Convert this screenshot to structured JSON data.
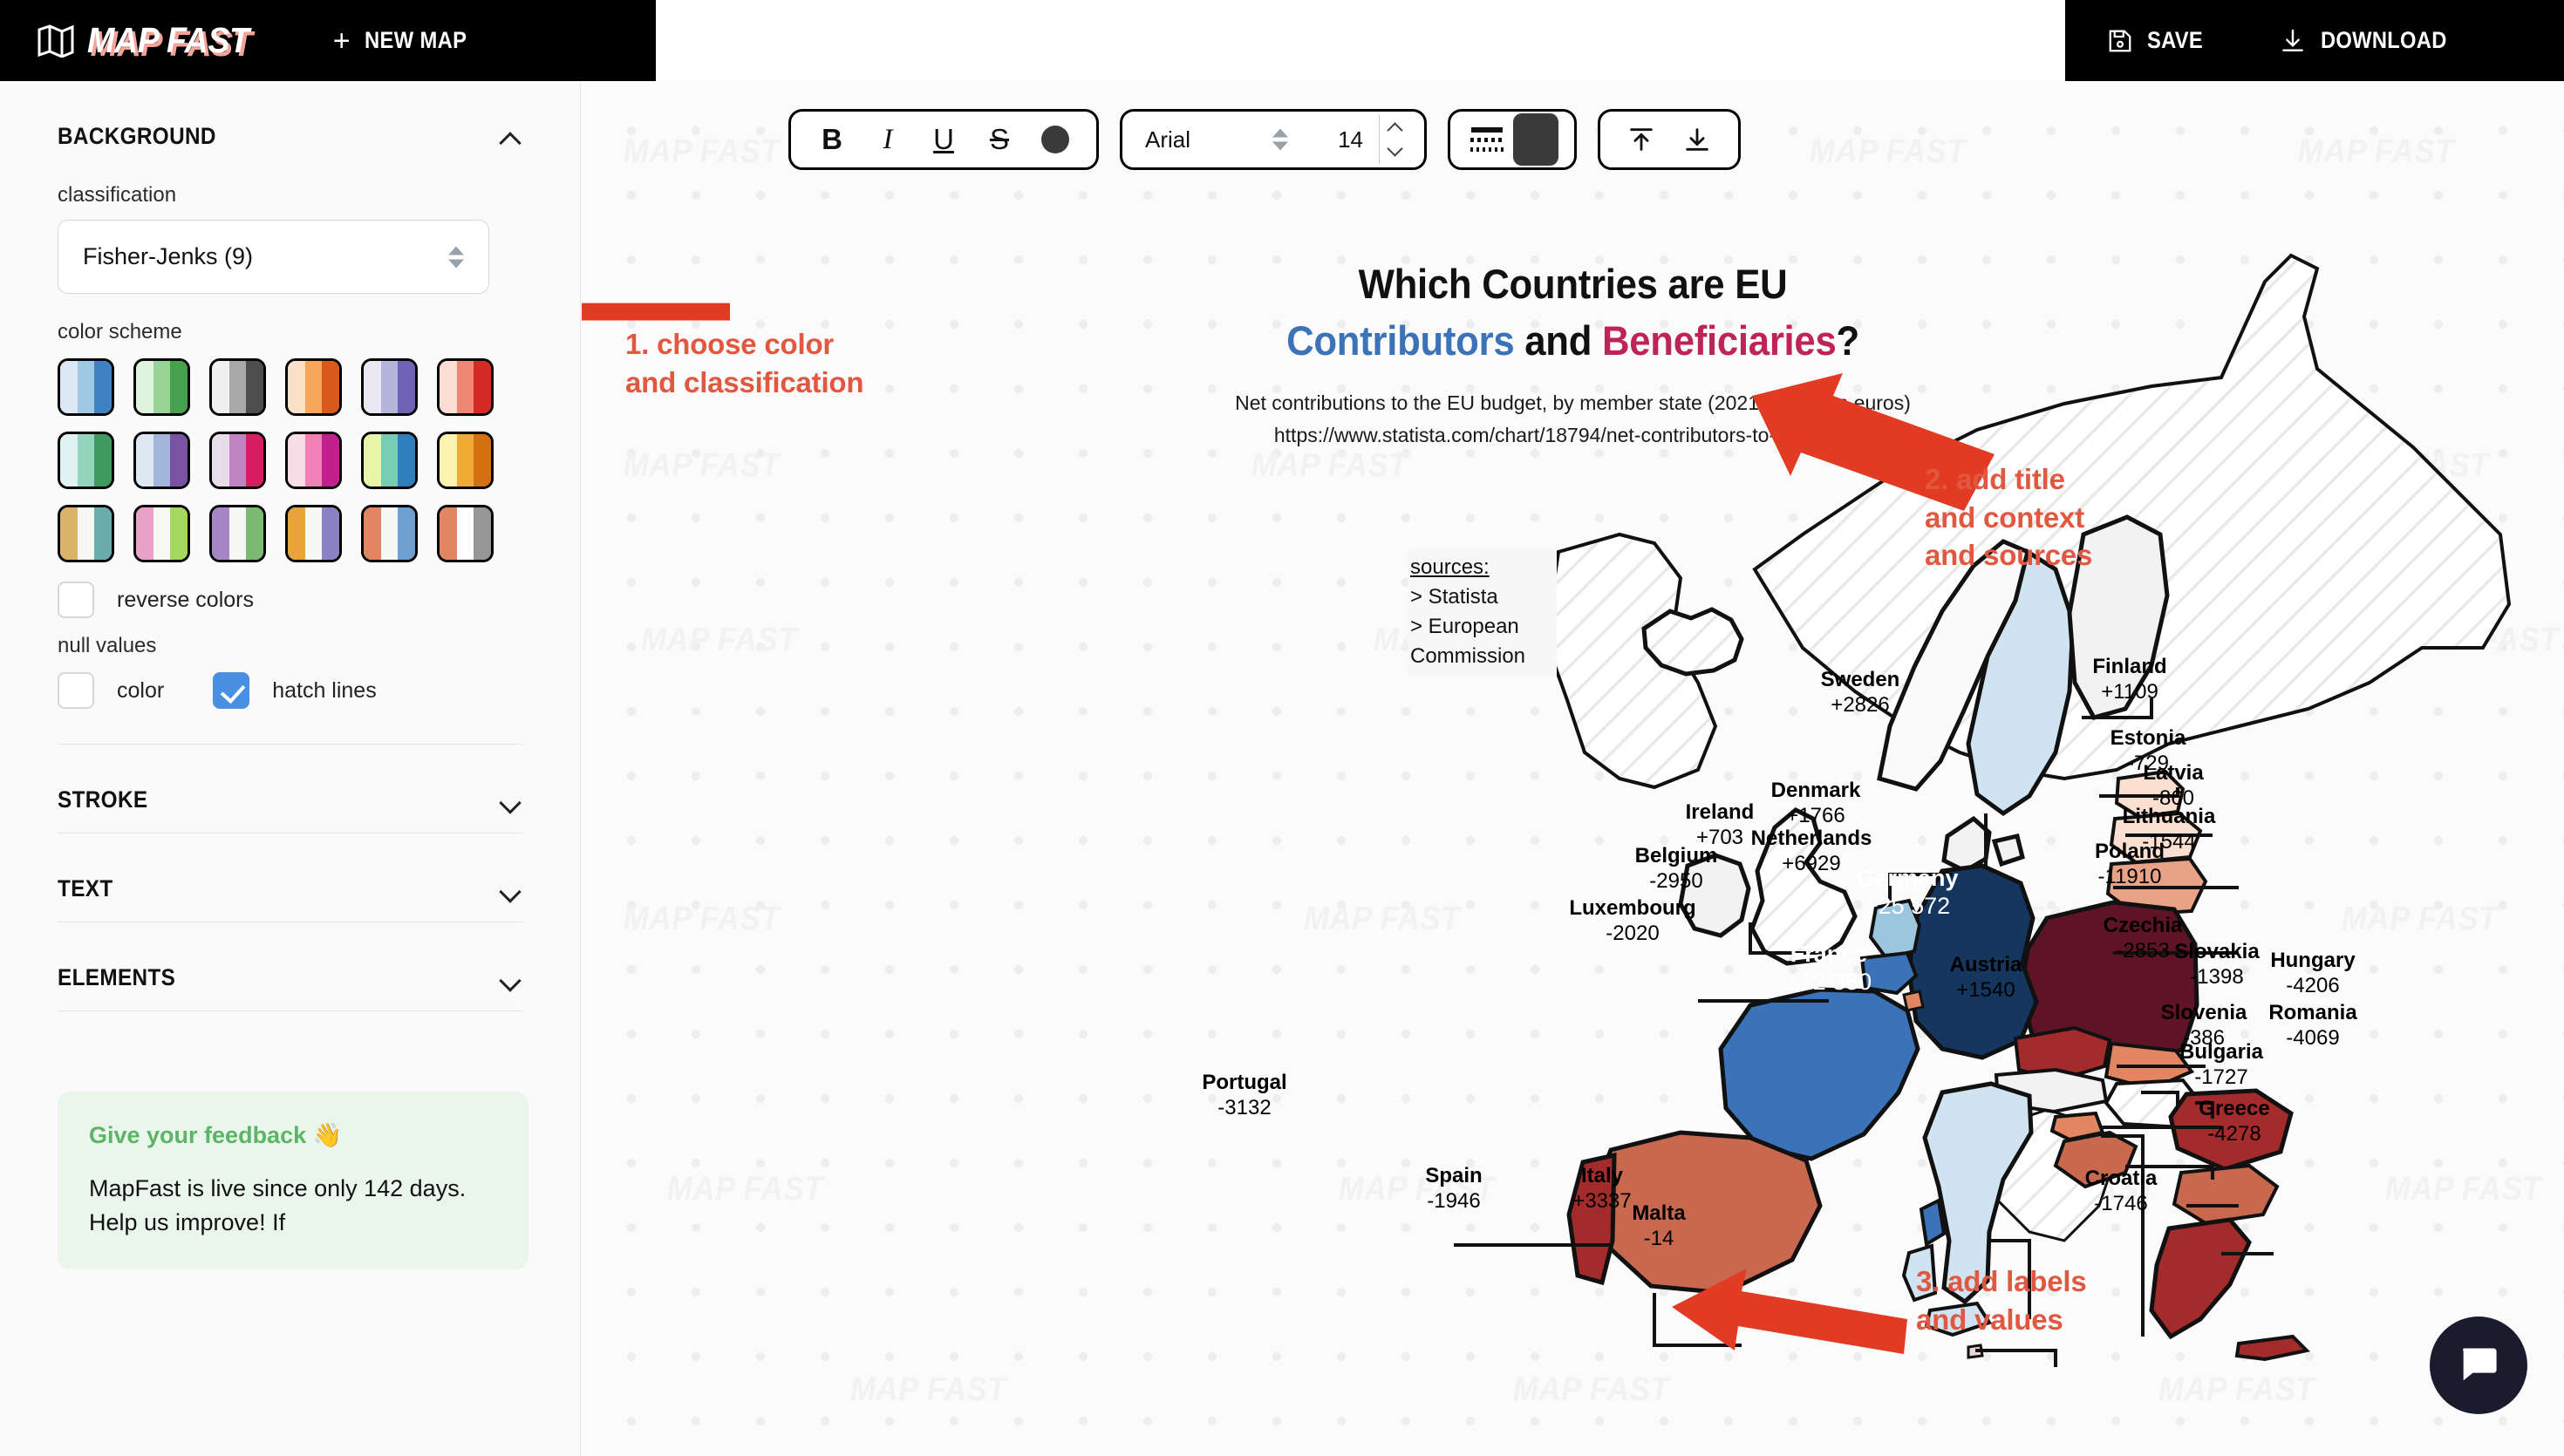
{
  "app": {
    "logo_text": "MAP FAST",
    "new_map_label": "NEW MAP",
    "plus": "+",
    "save_label": "SAVE",
    "download_label": "DOWNLOAD"
  },
  "sidebar": {
    "sections": [
      {
        "title": "BACKGROUND",
        "expanded": true
      },
      {
        "title": "STROKE",
        "expanded": false
      },
      {
        "title": "TEXT",
        "expanded": false
      },
      {
        "title": "ELEMENTS",
        "expanded": false
      }
    ],
    "background": {
      "classification_label": "classification",
      "classification_value": "Fisher-Jenks (9)",
      "color_scheme_label": "color scheme",
      "reverse_colors_label": "reverse colors",
      "reverse_colors_checked": false,
      "null_values_label": "null values",
      "null_color_label": "color",
      "null_color_checked": false,
      "null_hatch_label": "hatch lines",
      "null_hatch_checked": true,
      "schemes": [
        [
          "#dce9f5",
          "#9ec8e4",
          "#3e81c1"
        ],
        [
          "#e0f3df",
          "#96d394",
          "#46a14d"
        ],
        [
          "#f0f0f0",
          "#a8a8a8",
          "#4d4d4d"
        ],
        [
          "#fbe0c8",
          "#f5a65b",
          "#d9591b"
        ],
        [
          "#e9e8f2",
          "#b5b4da",
          "#6f61b5"
        ],
        [
          "#fbdfd5",
          "#ee8774",
          "#d32b23"
        ],
        [
          "#e0f2f2",
          "#93d4bd",
          "#3f9a5f"
        ],
        [
          "#dde8f3",
          "#a3b6d9",
          "#7a52a3"
        ],
        [
          "#e6dcea",
          "#c084c2",
          "#d91d62"
        ],
        [
          "#f8dce6",
          "#f27fb5",
          "#c41f8e"
        ],
        [
          "#e8f4a8",
          "#79ccb4",
          "#2f7fbd"
        ],
        [
          "#fcf3b0",
          "#f0ab35",
          "#d4700f"
        ],
        [
          "#d9b468",
          "#f6f6f4",
          "#69aeac"
        ],
        [
          "#e8a2c8",
          "#f7f7f5",
          "#a5d65e"
        ],
        [
          "#a487c4",
          "#f6f6f4",
          "#7cb972"
        ],
        [
          "#e9a33d",
          "#f7f7f5",
          "#8a82c4"
        ],
        [
          "#e28561",
          "#f7f7f5",
          "#6fa0cd"
        ],
        [
          "#e28561",
          "#ffffff",
          "#969696"
        ]
      ]
    },
    "feedback": {
      "title": "Give your feedback 👋",
      "body": "MapFast is live since only 142 days. Help us improve! If"
    }
  },
  "toolbar": {
    "bold": "B",
    "italic": "I",
    "underline": "U",
    "strike": "S",
    "text_color": "#3a3a3a",
    "font_family": "Arial",
    "font_size": "14",
    "fill_color": "#3a3a3a"
  },
  "map": {
    "title_line1": "Which Countries are EU",
    "title_part_contributors": "Contributors",
    "title_part_and": " and ",
    "title_part_beneficiaries": "Beneficiaries",
    "title_part_q": "?",
    "subtitle": "Net contributions to the EU budget, by member state (2021, in million euros)",
    "source_url": "https://www.statista.com/chart/18794/net-contributors-to-eu-budget/",
    "sources_heading": "sources:",
    "sources_items": [
      "> Statista",
      "> European Commission"
    ],
    "watermark": "MAP FAST",
    "colors": {
      "contributor_strong": "#14365f",
      "contributor_mid": "#3b72b8",
      "contributor_light": "#9cc6e0",
      "contributor_pale": "#cfe3f0",
      "beneficiary_strong": "#5e1424",
      "beneficiary_mid": "#a32b2b",
      "beneficiary_light": "#c8684f",
      "beneficiary_pale": "#f0c3ae",
      "null_fill": "#ffffff",
      "annotation": "#e2573f"
    }
  },
  "annotations": [
    {
      "id": 1,
      "text": "1. choose color\nand classification"
    },
    {
      "id": 2,
      "text": "2. add title\nand context\nand sources"
    },
    {
      "id": 3,
      "text": "3. add labels\nand values"
    }
  ],
  "chart_data": {
    "type": "choropleth-map",
    "title": "Which Countries are EU Contributors and Beneficiaries?",
    "subtitle": "Net contributions to the EU budget, by member state (2021, in million euros)",
    "unit": "million euros",
    "classification": "Fisher-Jenks (9)",
    "values": [
      {
        "country": "Germany",
        "value": 25572,
        "label": "+25 572"
      },
      {
        "country": "France",
        "value": 12380,
        "label": "+12 380"
      },
      {
        "country": "Netherlands",
        "value": 6929,
        "label": "+6929"
      },
      {
        "country": "Italy",
        "value": 3337,
        "label": "+3337"
      },
      {
        "country": "Sweden",
        "value": 2826,
        "label": "+2826"
      },
      {
        "country": "Denmark",
        "value": 1766,
        "label": "+1766"
      },
      {
        "country": "Austria",
        "value": 1540,
        "label": "+1540"
      },
      {
        "country": "Finland",
        "value": 1109,
        "label": "+1109"
      },
      {
        "country": "Ireland",
        "value": 703,
        "label": "+703"
      },
      {
        "country": "Malta",
        "value": -14,
        "label": "-14"
      },
      {
        "country": "Slovenia",
        "value": -386,
        "label": "-386"
      },
      {
        "country": "Estonia",
        "value": -729,
        "label": "-729"
      },
      {
        "country": "Latvia",
        "value": -860,
        "label": "-860"
      },
      {
        "country": "Slovakia",
        "value": -1398,
        "label": "-1398"
      },
      {
        "country": "Lithuania",
        "value": -1544,
        "label": "-1544"
      },
      {
        "country": "Bulgaria",
        "value": -1727,
        "label": "-1727"
      },
      {
        "country": "Croatia",
        "value": -1746,
        "label": "-1746"
      },
      {
        "country": "Spain",
        "value": -1946,
        "label": "-1946"
      },
      {
        "country": "Luxembourg",
        "value": -2020,
        "label": "-2020"
      },
      {
        "country": "Czechia",
        "value": -2853,
        "label": "-2853"
      },
      {
        "country": "Belgium",
        "value": -2950,
        "label": "-2950"
      },
      {
        "country": "Portugal",
        "value": -3132,
        "label": "-3132"
      },
      {
        "country": "Romania",
        "value": -4069,
        "label": "-4069"
      },
      {
        "country": "Hungary",
        "value": -4206,
        "label": "-4206"
      },
      {
        "country": "Greece",
        "value": -4278,
        "label": "-4278"
      },
      {
        "country": "Poland",
        "value": -11910,
        "label": "-11910"
      }
    ]
  }
}
